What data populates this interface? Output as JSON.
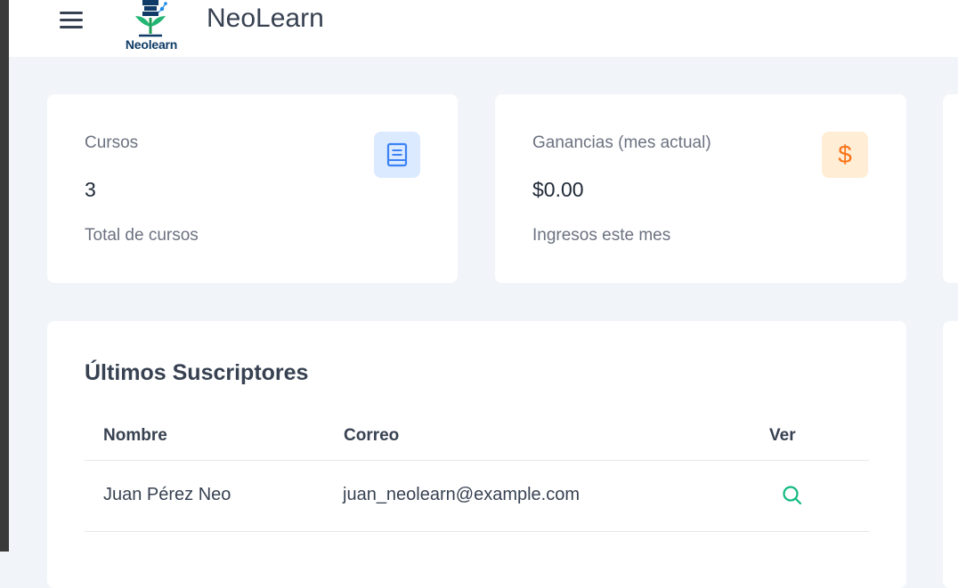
{
  "header": {
    "logo_text": "Neolearn",
    "brand": "NeoLearn"
  },
  "stats": [
    {
      "title": "Cursos",
      "value": "3",
      "subtitle": "Total de cursos",
      "icon": "book-icon",
      "icon_color": "#3b82f6",
      "icon_bg": "#dbeafe"
    },
    {
      "title": "Ganancias (mes actual)",
      "value": "$0.00",
      "subtitle": "Ingresos este mes",
      "icon": "dollar-icon",
      "icon_glyph": "$",
      "icon_color": "#f97316",
      "icon_bg": "#ffedd5"
    }
  ],
  "subscribers": {
    "title": "Últimos Suscriptores",
    "columns": [
      "Nombre",
      "Correo",
      "Ver"
    ],
    "rows": [
      {
        "name": "Juan Pérez Neo",
        "email": "juan_neolearn@example.com"
      }
    ]
  },
  "colors": {
    "accent_green": "#10b981",
    "brand_navy": "#0f3b66",
    "page_bg": "#f1f4f8"
  }
}
